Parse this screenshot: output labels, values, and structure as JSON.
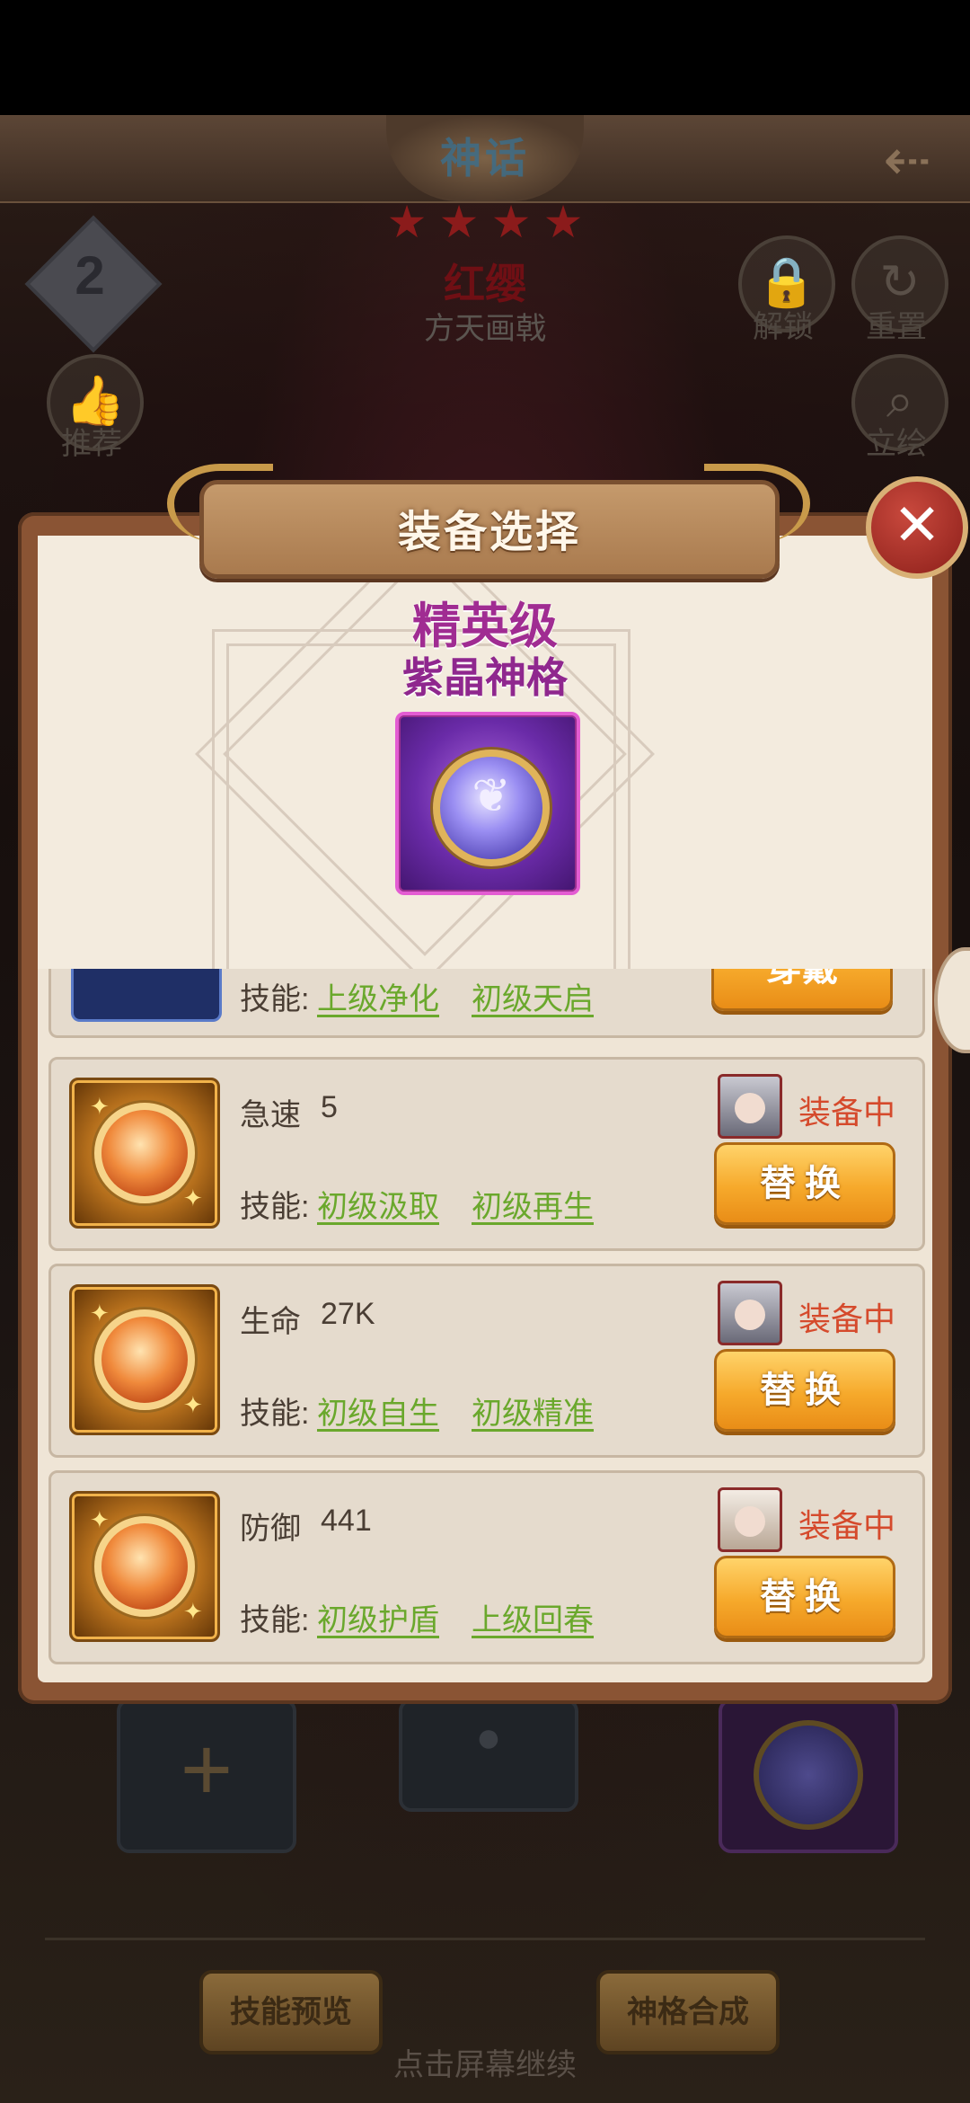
{
  "header": {
    "tier_label": "神话",
    "stars": [
      "★",
      "★",
      "★",
      "★"
    ],
    "level_badge": "2",
    "hero_name": "红缨",
    "weapon": "方天画戟"
  },
  "side_buttons": {
    "unlock": "解锁",
    "reset": "重置",
    "recommend": "推荐",
    "portrait": "立绘"
  },
  "modal": {
    "title": "装备选择",
    "close_label": "✕",
    "preview": {
      "grade": "精英级",
      "name": "紫晶神格"
    },
    "partial_item": {
      "skills_label": "技能:",
      "skills": [
        "上级净化",
        "初级天启"
      ],
      "button_label": "穿戴"
    },
    "items": [
      {
        "stat_name": "急速",
        "stat_value": "5",
        "skills_label": "技能:",
        "skills": [
          "初级汲取",
          "初级再生"
        ],
        "status": "装备中",
        "button_label": "替换"
      },
      {
        "stat_name": "生命",
        "stat_value": "27K",
        "skills_label": "技能:",
        "skills": [
          "初级自生",
          "初级精准"
        ],
        "status": "装备中",
        "button_label": "替换"
      },
      {
        "stat_name": "防御",
        "stat_value": "441",
        "skills_label": "技能:",
        "skills": [
          "初级护盾",
          "上级回春"
        ],
        "status": "装备中",
        "button_label": "替换"
      }
    ]
  },
  "bottom": {
    "skill_preview": "技能预览",
    "synthesis": "神格合成",
    "continue_hint": "点击屏幕继续"
  },
  "colors": {
    "modal_frame": "#8a5434",
    "modal_bg": "#efe5d6",
    "grade_purple": "#a02c92",
    "skill_green": "#6aa82c",
    "equipped_red": "#d54a2c",
    "button_orange": "#f6a92b"
  }
}
